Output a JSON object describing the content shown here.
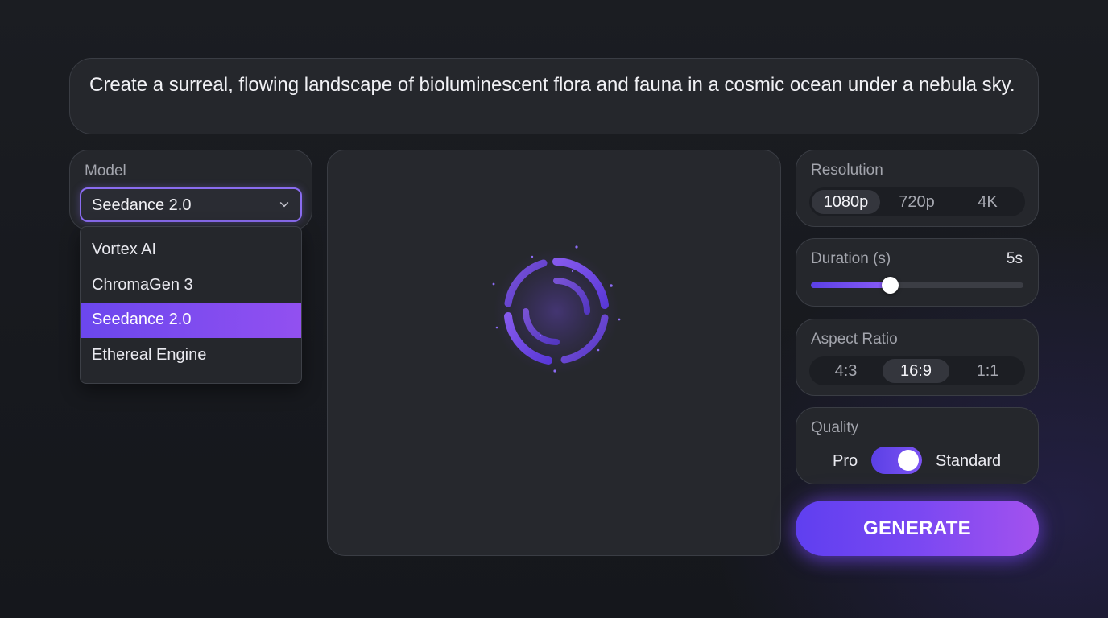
{
  "prompt": {
    "text": "Create a surreal, flowing landscape of bioluminescent flora and fauna in a cosmic ocean under a nebula sky."
  },
  "model": {
    "label": "Model",
    "selected": "Seedance 2.0",
    "options": [
      "Vortex AI",
      "ChromaGen 3",
      "Seedance 2.0",
      "Ethereal Engine"
    ]
  },
  "resolution": {
    "label": "Resolution",
    "options": [
      "1080p",
      "720p",
      "4K"
    ],
    "selected": "1080p"
  },
  "duration": {
    "label": "Duration (s)",
    "value": "5s",
    "slider_fraction": 0.37
  },
  "aspect_ratio": {
    "label": "Aspect Ratio",
    "options": [
      "4:3",
      "16:9",
      "1:1"
    ],
    "selected": "16:9"
  },
  "quality": {
    "label": "Quality",
    "left_label": "Pro",
    "right_label": "Standard",
    "toggle_on": true
  },
  "generate": {
    "label": "GENERATE"
  },
  "colors": {
    "accent": "#7b4ff2",
    "accent_end": "#a352ee",
    "surface": "#25272c",
    "background": "#17191e"
  },
  "icons": {
    "select_chevron": "chevron-down-icon",
    "preview_loader": "spinner-icon"
  }
}
